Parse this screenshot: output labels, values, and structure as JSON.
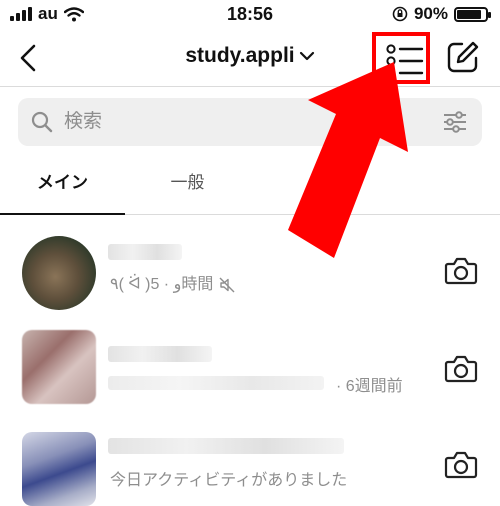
{
  "status": {
    "carrier": "au",
    "time": "18:56",
    "battery": "90%",
    "battery_level": 0.9
  },
  "nav": {
    "title": "study.appli"
  },
  "search": {
    "placeholder": "検索"
  },
  "tabs": [
    {
      "label": "メイン",
      "active": true
    },
    {
      "label": "一般",
      "active": false
    }
  ],
  "threads": [
    {
      "preview": "٩( ᐛ )و · 5時間",
      "muted": true
    },
    {
      "preview": "· 6週間前"
    },
    {
      "preview": "今日アクティビティがありました"
    }
  ],
  "colors": {
    "highlight": "#ff0000",
    "arrow": "#ff0000",
    "secondary_text": "#8e8e8e"
  }
}
